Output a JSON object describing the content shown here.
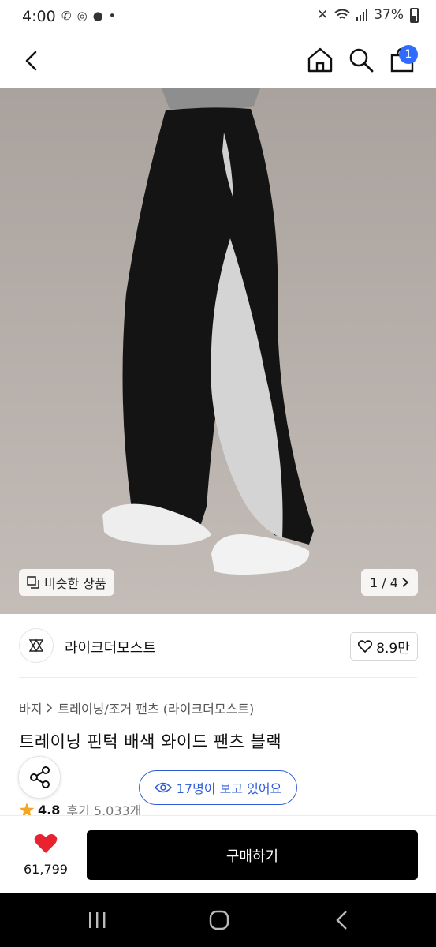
{
  "status_bar": {
    "time": "4:00",
    "battery": "37%"
  },
  "nav": {
    "cart_count": "1"
  },
  "image": {
    "similar_label": "비슷한 상품",
    "page_counter": "1 / 4"
  },
  "brand": {
    "name": "라이크더모스트",
    "like_count": "8.9만"
  },
  "breadcrumb": {
    "category": "바지",
    "subcategory": "트레이닝/조거 팬츠 (라이크더모스트)"
  },
  "product": {
    "title": "트레이닝 핀턱 배색 와이드 팬츠 블랙",
    "viewers": "17명이 보고 있어요",
    "rating": "4.8",
    "reviews": "후기 5,033개"
  },
  "bottom_bar": {
    "heart_count": "61,799",
    "buy_label": "구매하기"
  },
  "colors": {
    "accent_blue": "#2f5bd6",
    "badge_blue": "#2f6bff",
    "heart_red": "#e8232f",
    "star_orange": "#f5a623",
    "buy_button": "#000000"
  },
  "icons": [
    "back-icon",
    "home-icon",
    "search-icon",
    "cart-icon",
    "similar-icon",
    "chevron-right-icon",
    "heart-outline-icon",
    "share-icon",
    "eye-icon",
    "star-icon",
    "heart-filled-icon",
    "recents-icon",
    "android-home-icon",
    "android-back-icon"
  ]
}
